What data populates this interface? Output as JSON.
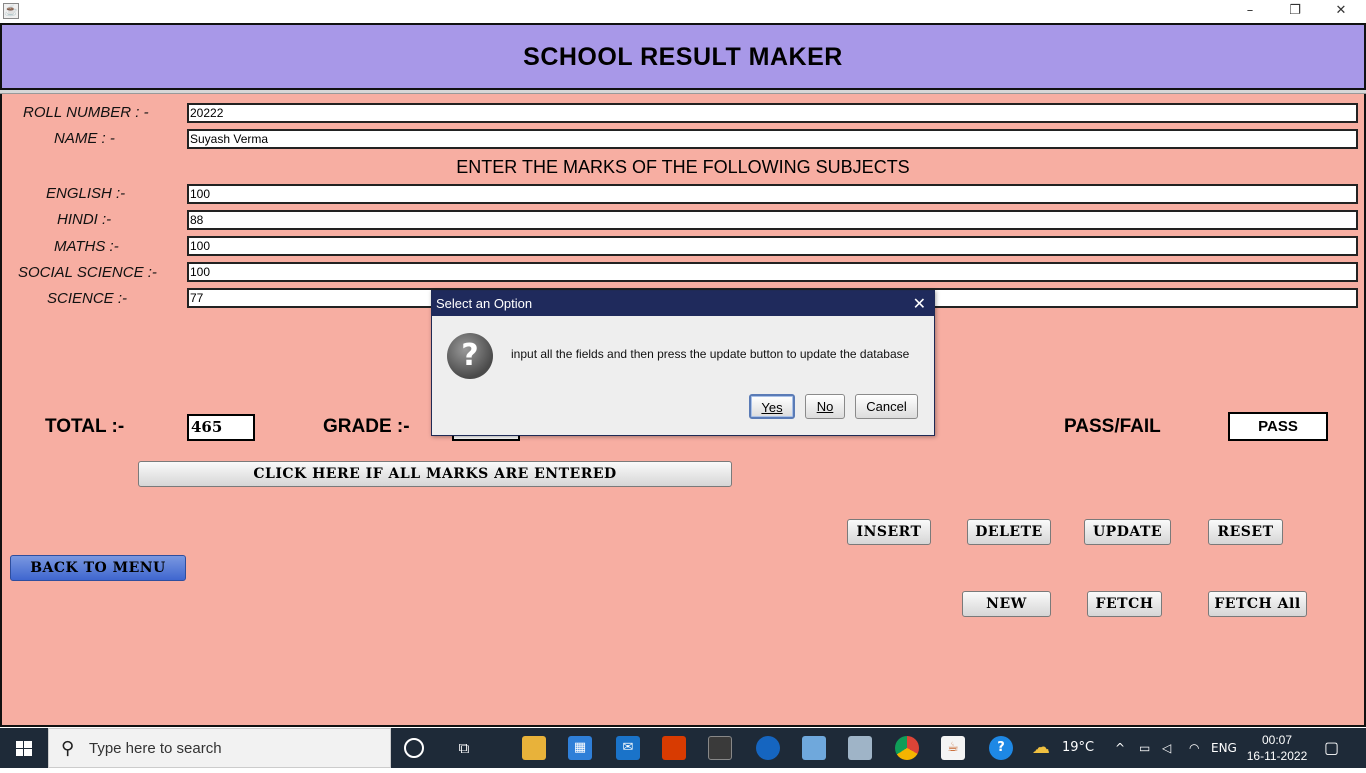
{
  "window": {
    "minimize": "–",
    "restore": "❐",
    "close": "✕"
  },
  "header": {
    "title": "SCHOOL RESULT MAKER"
  },
  "form": {
    "roll_label": "ROLL NUMBER : -",
    "roll_value": "20222",
    "name_label": "NAME : -",
    "name_value": "Suyash Verma",
    "subheading": "ENTER THE MARKS OF THE FOLLOWING SUBJECTS",
    "subjects": [
      {
        "label": "ENGLISH :-",
        "value": "100"
      },
      {
        "label": "HINDI :-",
        "value": "88"
      },
      {
        "label": "MATHS :-",
        "value": "100"
      },
      {
        "label": "SOCIAL SCIENCE :-",
        "value": "100"
      },
      {
        "label": "SCIENCE :-",
        "value": "77"
      }
    ]
  },
  "results": {
    "total_label": "TOTAL :-",
    "total_value": "465",
    "grade_label": "GRADE :-",
    "grade_value": "",
    "passfail_label": "PASS/FAIL",
    "passfail_value": "PASS"
  },
  "buttons": {
    "calculate": "CLICK HERE IF ALL MARKS ARE ENTERED",
    "insert": "INSERT",
    "delete": "DELETE",
    "update": "UPDATE",
    "reset": "RESET",
    "back": "BACK TO MENU",
    "new": "NEW",
    "fetch": "FETCH",
    "fetch_all": "FETCH All"
  },
  "dialog": {
    "title": "Select an Option",
    "close": "✕",
    "icon": "question-icon",
    "message": "input all the fields and then press the update button to update the database",
    "yes": "Yes",
    "no": "No",
    "cancel": "Cancel"
  },
  "taskbar": {
    "search_placeholder": "Type here to search",
    "weather": "19°C",
    "language": "ENG",
    "time": "00:07",
    "date": "16-11-2022"
  }
}
